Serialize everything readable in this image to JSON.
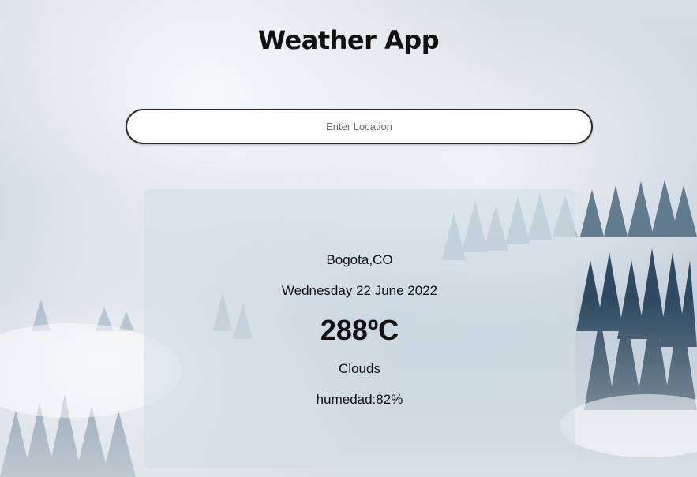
{
  "app": {
    "title": "Weather App"
  },
  "search": {
    "placeholder": "Enter Location",
    "value": ""
  },
  "weather": {
    "location": "Bogota,CO",
    "date": "Wednesday 22 June 2022",
    "temperature": "288ºC",
    "condition": "Clouds",
    "humidity": "humedad:82%"
  },
  "colors": {
    "title_text": "#111111",
    "input_border": "#2a2a2a",
    "input_background": "#ffffff",
    "card_background": "rgba(210,222,230,0.55)"
  }
}
